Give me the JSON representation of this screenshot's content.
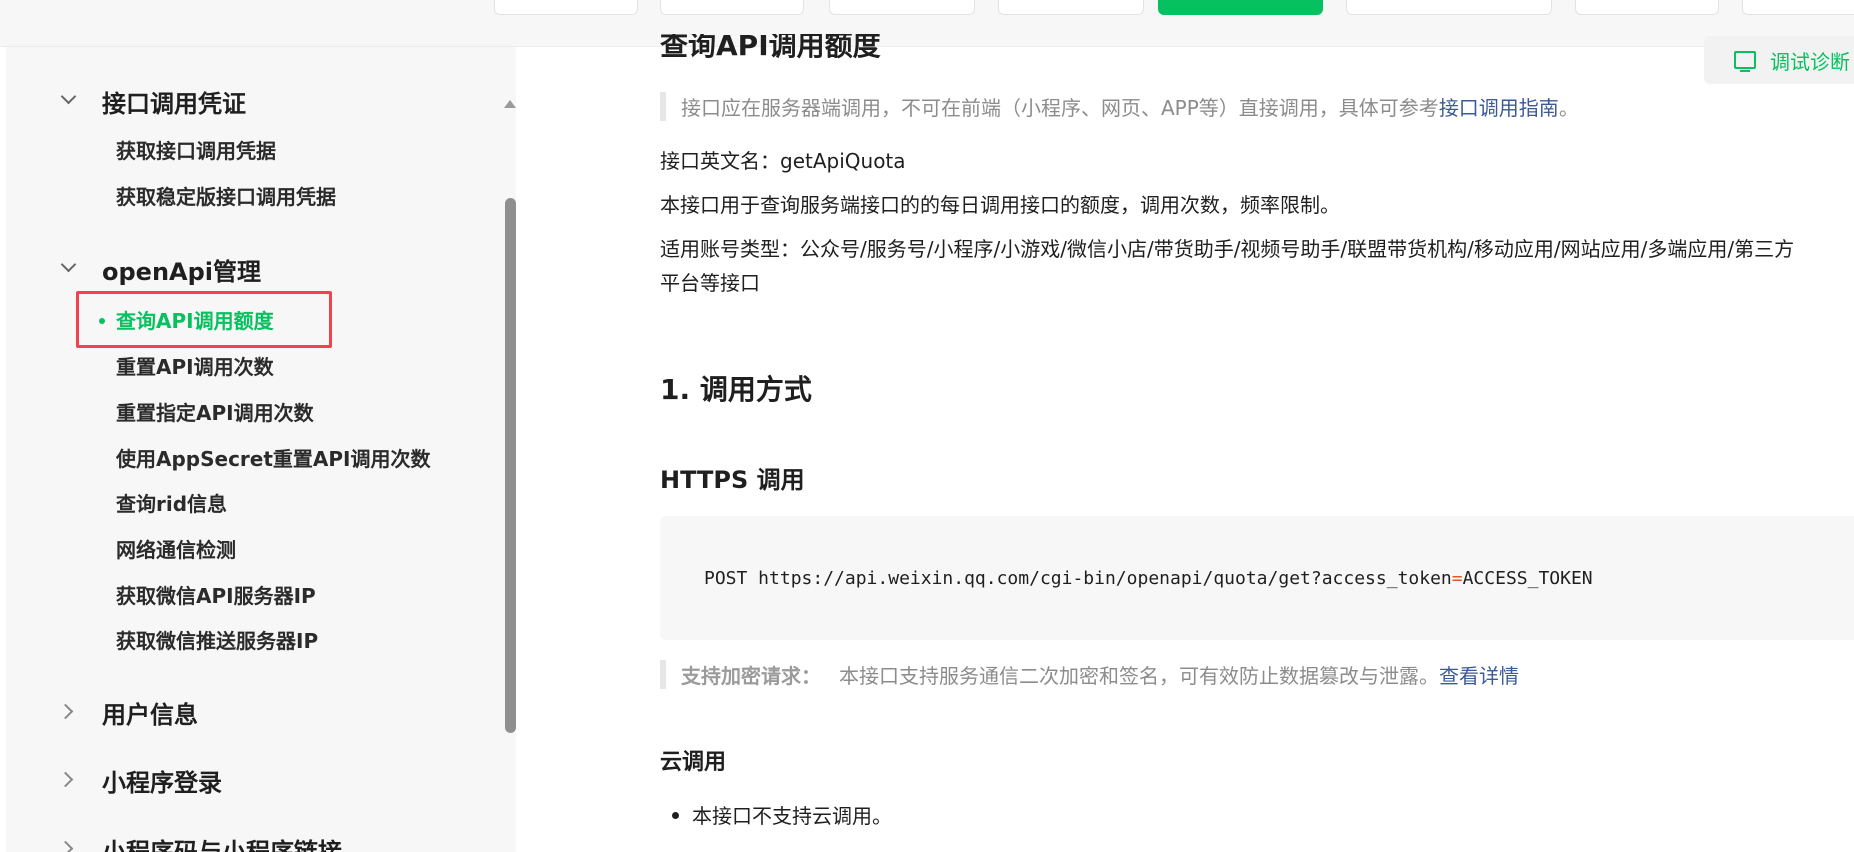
{
  "sidebar": {
    "groups": [
      {
        "label": "接口调用凭证",
        "expanded": true,
        "items": [
          "获取接口调用凭据",
          "获取稳定版接口调用凭据"
        ]
      },
      {
        "label": "openApi管理",
        "expanded": true,
        "items": [
          "查询API调用额度",
          "重置API调用次数",
          "重置指定API调用次数",
          "使用AppSecret重置API调用次数",
          "查询rid信息",
          "网络通信检测",
          "获取微信API服务器IP",
          "获取微信推送服务器IP"
        ]
      },
      {
        "label": "用户信息",
        "expanded": false
      },
      {
        "label": "小程序登录",
        "expanded": false
      },
      {
        "label": "小程序码与小程序链接",
        "expanded": false
      }
    ],
    "active_item": "查询API调用额度"
  },
  "main": {
    "title": "查询API调用额度",
    "debug_button": "调试诊断",
    "notice_text": "接口应在服务器端调用，不可在前端（小程序、网页、APP等）直接调用，具体可参考",
    "notice_link": "接口调用指南",
    "notice_end": "。",
    "english_name": "接口英文名：getApiQuota",
    "description": "本接口用于查询服务端接口的的每日调用接口的额度，调用次数，频率限制。",
    "account_types_line1": "适用账号类型：公众号/服务号/小程序/小游戏/微信小店/带货助手/视频号助手/联盟带货机构/移动应用/网站应用/多端应用/第三方",
    "account_types_line2": "平台等接口",
    "section1": "1. 调用方式",
    "https_heading": "HTTPS 调用",
    "code_prefix": "POST https://api.weixin.qq.com/cgi-bin/openapi/quota/get?access_token",
    "code_op": "=",
    "code_suffix": "ACCESS_TOKEN",
    "encrypt_label": "支持加密请求：",
    "encrypt_text": "本接口支持服务通信二次加密和签名，可有效防止数据篡改与泄露。",
    "encrypt_link": "查看详情",
    "cloud_heading": "云调用",
    "cloud_bullet": "本接口不支持云调用。"
  },
  "colors": {
    "accent": "#07c160",
    "highlight": "#f2424f",
    "link": "#3c5b96"
  }
}
